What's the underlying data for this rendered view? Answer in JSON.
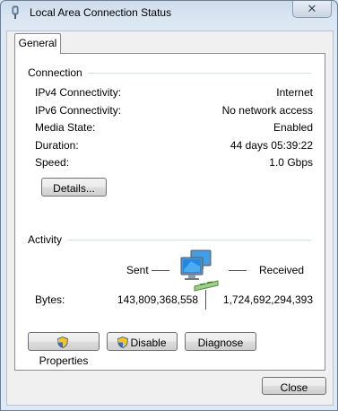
{
  "window": {
    "title": "Local Area Connection Status",
    "close_glyph": "✕"
  },
  "tabs": [
    {
      "label": "General"
    }
  ],
  "connection": {
    "group_label": "Connection",
    "rows": [
      {
        "label": "IPv4 Connectivity:",
        "value": "Internet"
      },
      {
        "label": "IPv6 Connectivity:",
        "value": "No network access"
      },
      {
        "label": "Media State:",
        "value": "Enabled"
      },
      {
        "label": "Duration:",
        "value": "44 days 05:39:22"
      },
      {
        "label": "Speed:",
        "value": "1.0 Gbps"
      }
    ],
    "details_label": "Details..."
  },
  "activity": {
    "group_label": "Activity",
    "sent_label": "Sent",
    "received_label": "Received",
    "bytes_label": "Bytes:",
    "bytes_sent": "143,809,368,558",
    "bytes_received": "1,724,692,294,393"
  },
  "buttons": {
    "properties": "Properties",
    "disable": "Disable",
    "diagnose": "Diagnose",
    "close": "Close"
  },
  "icons": {
    "title": "network-connection-icon",
    "activity": "network-computers-icon",
    "shield": "uac-shield-icon"
  }
}
